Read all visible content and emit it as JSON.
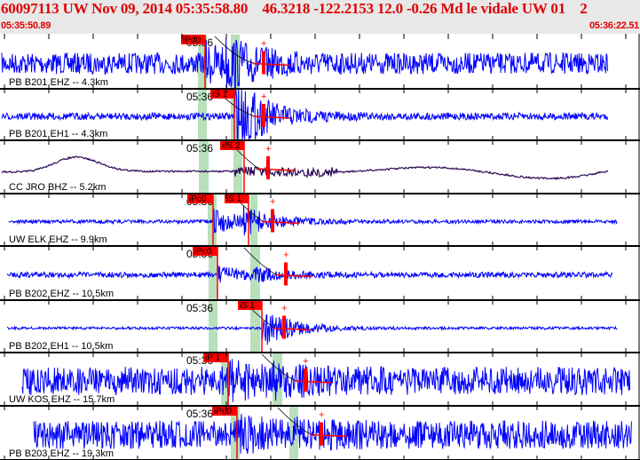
{
  "header": {
    "title": "60097113 UW Nov 09, 2014 05:35:58.80    46.3218 -122.2153 12.0 -0.26 Md le vidale UW 01    2",
    "start_time": "05:35:50.89",
    "end_time": "05:36:22.51"
  },
  "colors": {
    "header_text": "#e00000",
    "trace": "#0000ff",
    "trace_long_period": "#2a0a55",
    "pick": "#ff0000",
    "pick_window": "#b7e0bb"
  },
  "minute_label": "05:36",
  "panels": [
    {
      "station": "PB B201 EHZ -- 4.3km",
      "trace": "short",
      "picks": [
        {
          "label": "iPd0"
        }
      ]
    },
    {
      "station": "PB B201 EH1 -- 4.3km",
      "trace": "short",
      "picks": [
        {
          "label": "iS 1"
        }
      ]
    },
    {
      "station": "CC JRO BHZ -- 5.2km",
      "trace": "long",
      "picks": [
        {
          "label": "eS 2"
        }
      ]
    },
    {
      "station": "UW ELK EHZ -- 9.9km",
      "trace": "short",
      "picks": [
        {
          "label": "iPc0"
        },
        {
          "label": "iS 1"
        }
      ]
    },
    {
      "station": "PB B202 EHZ -- 10.5km",
      "trace": "short",
      "picks": [
        {
          "label": "iPc0"
        }
      ]
    },
    {
      "station": "PB B202 EH1 -- 10.5km",
      "trace": "short",
      "picks": [
        {
          "label": "iS 1"
        }
      ]
    },
    {
      "station": "UW KOS EHZ -- 15.7km",
      "trace": "short",
      "picks": [
        {
          "label": "iP 1"
        }
      ]
    },
    {
      "station": "PB B203 EHZ -- 19.3km",
      "trace": "short",
      "picks": [
        {
          "label": "iPd0"
        }
      ]
    }
  ]
}
